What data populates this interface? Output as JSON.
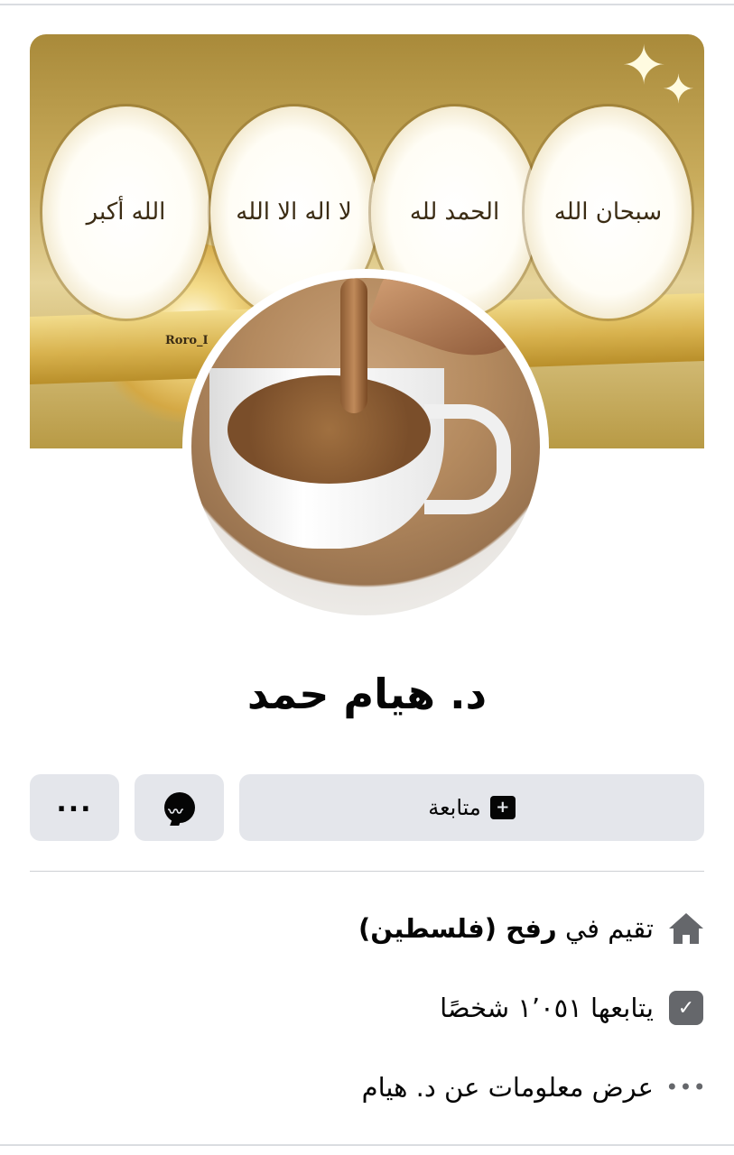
{
  "cover": {
    "frames": [
      "سبحان الله",
      "الحمد لله",
      "لا اله الا الله",
      "الله أكبر"
    ],
    "watermark": "Roro_I"
  },
  "profile": {
    "name": "د. هيام حمد"
  },
  "actions": {
    "follow_label": "متابعة",
    "follow_icon": "follow-plus-icon",
    "message_icon": "messenger-icon",
    "more_label": "..."
  },
  "details": {
    "lives_prefix": "تقيم في",
    "lives_place": "رفح (فلسطين)",
    "followers": "يتابعها ١٬٠٥١ شخصًا",
    "about": "عرض معلومات عن د. هيام"
  }
}
